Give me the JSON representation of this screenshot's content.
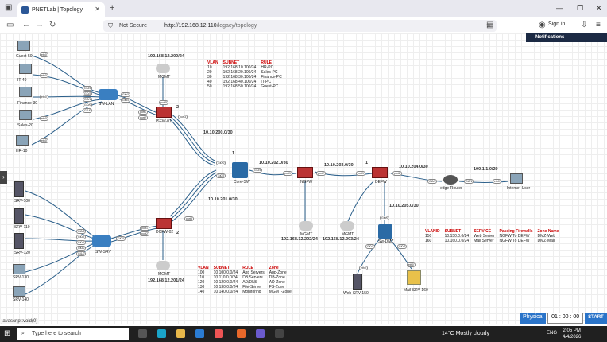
{
  "browser": {
    "tab_title": "PNETLab | Topology",
    "security": "Not Secure",
    "url_host": "http://192.168.12.110",
    "url_path": "/legacy/topology",
    "sign_in": "Sign in",
    "notifications": "Notifications",
    "status_link": "javascript:void(0)"
  },
  "hosts": {
    "guest": "Guest-50",
    "it": "IT-40",
    "finance": "Finance-30",
    "sales": "Sales-20",
    "hr": "HR-10",
    "srv100": "SRV-100",
    "srv110": "SRV-110",
    "srv120": "SRV-120",
    "srv130": "SRV-130",
    "srv140": "SRV-140"
  },
  "devices": {
    "sw_lan": "SW-LAN",
    "sw_srv": "SW-SRV",
    "isfw": "ISFW-01",
    "dcfw": "DCFW-02",
    "core": "Core-SW",
    "ngfw": "NGFW",
    "defw": "DEFW",
    "edge": "edge-Router",
    "internet": "Internet-User",
    "dmz": "Sw-DMZ",
    "web": "Web-SRV-150",
    "mail": "Mail-SRV-160",
    "mgmt": "MGMT"
  },
  "networks": {
    "n1": "192.168.12.200/24",
    "n2": "10.10.200.0/30",
    "n3": "10.10.201.0/30",
    "n4": "192.168.12.201/24",
    "n5": "10.10.202.0/30",
    "n6": "192.168.12.202/24",
    "n7": "10.10.203.0/30",
    "n8": "192.168.12.203/24",
    "n9": "10.10.204.0/30",
    "n10": "100.1.1.0/29",
    "n11": "10.10.205.0/30"
  },
  "ports": {
    "e0": "eth0",
    "e1": "eth1",
    "g00": "Gi0/0",
    "g01": "Gi0/1",
    "g02": "Gi0/2",
    "g03": "Gi0/3",
    "g10": "Gi1/0",
    "p1": "port1",
    "p2": "port2",
    "p3": "port3",
    "p5": "port5",
    "n1": "1",
    "n2": "2"
  },
  "lan_table": {
    "headers": [
      "VLAN",
      "SUBNET",
      "RULE"
    ],
    "rows": [
      [
        "10",
        "192.168.10.100/24",
        "HR-PC"
      ],
      [
        "20",
        "192.168.20.100/24",
        "Sales-PC"
      ],
      [
        "30",
        "192.168.30.100/24",
        "Finance-PC"
      ],
      [
        "40",
        "192.168.40.100/24",
        "IT-PC"
      ],
      [
        "50",
        "192.168.50.100/24",
        "Guest-PC"
      ]
    ]
  },
  "srv_table": {
    "headers": [
      "VLAN",
      "SUBNET",
      "RULE",
      "Zone"
    ],
    "rows": [
      [
        "100",
        "10.100.0.0/24",
        "App Servers",
        "App-Zone"
      ],
      [
        "110",
        "10.110.0.0/24",
        "DB Servers",
        "DB-Zone"
      ],
      [
        "120",
        "10.120.0.0/24",
        "AD/DNS",
        "AD-Zone"
      ],
      [
        "130",
        "10.130.0.0/24",
        "File-Server",
        "FS-Zone"
      ],
      [
        "140",
        "10.140.0.0/24",
        "Monitoring",
        "MGMT-Zone"
      ]
    ]
  },
  "dmz_table": {
    "headers": [
      "VLANID",
      "SUBNET",
      "SERVICE",
      "Passing Firewalls",
      "Zone Name"
    ],
    "rows": [
      [
        "150",
        "10.150.0.0/24",
        "Web Server",
        "NGFW  To  DEFW",
        "DMZ-Web"
      ],
      [
        "160",
        "10.160.0.0/24",
        "Mail  Server",
        "NGFW  To  DEFW",
        "DMZ-Mail"
      ]
    ]
  },
  "runbar": {
    "mode": "Physical",
    "h": "01",
    "m": "00",
    "s": "00",
    "start": "START"
  },
  "taskbar": {
    "search": "Type here to search",
    "temp": "14°C",
    "weather": "Mostly cloudy",
    "lang": "ENG",
    "time": "2:05 PM",
    "date": "4/4/2026"
  }
}
